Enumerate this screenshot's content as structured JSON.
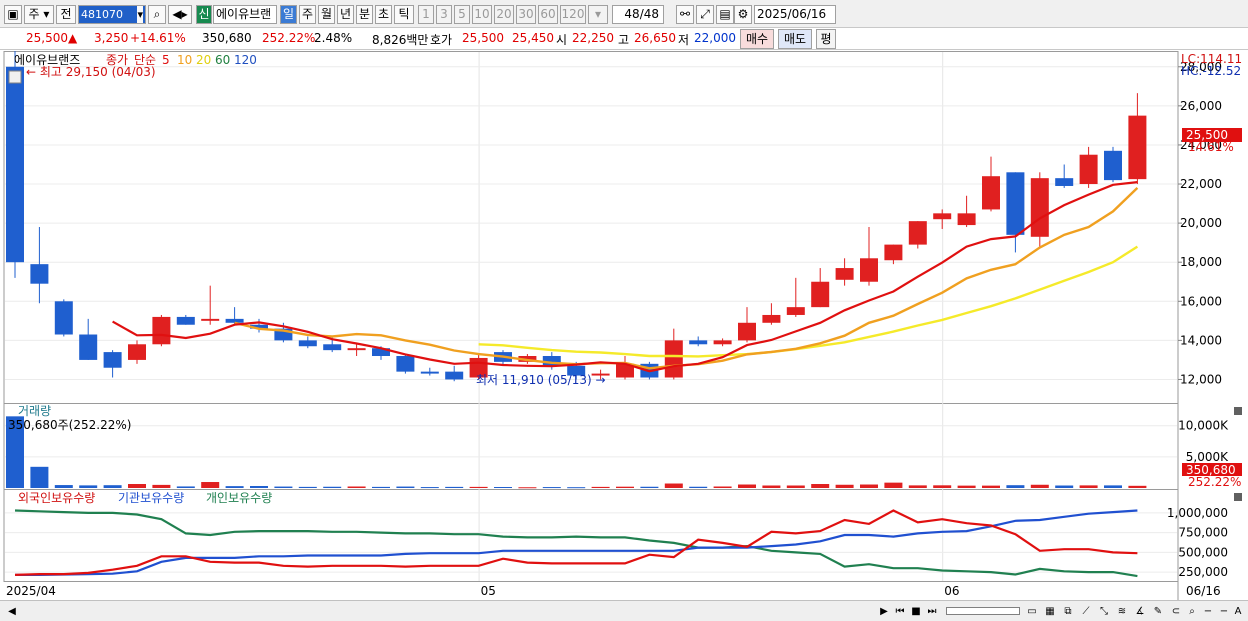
{
  "toolbar": {
    "period_main": "주",
    "prev_label": "전",
    "code": "481070",
    "credit_badge": "신",
    "stock_name": "에이유브랜",
    "periods": [
      "일",
      "주",
      "월",
      "년",
      "분",
      "초",
      "틱"
    ],
    "active_period": "일",
    "intervals": [
      "1",
      "3",
      "5",
      "10",
      "20",
      "30",
      "60",
      "120"
    ],
    "counter": "48",
    "counter_total": "/48",
    "date": "2025/06/16"
  },
  "quote": {
    "price": "25,500",
    "change": "3,250",
    "change_pct": "+14.61%",
    "volume": "350,680",
    "volume_ratio": "252.22%",
    "turnover_pct": "2.48%",
    "amount": "8,826백만",
    "ask_label": "호가",
    "ask": "25,500",
    "bid": "25,450",
    "open_label": "시",
    "open": "22,250",
    "high_label": "고",
    "high": "26,650",
    "low_label": "저",
    "low": "22,000",
    "buy_btn": "매수",
    "sell_btn": "매도",
    "eval_btn": "평"
  },
  "chart_data": {
    "type": "candlestick",
    "stock": "에이유브랜즈",
    "legend": {
      "close_label": "종가",
      "ma_label": "단순",
      "ma": [
        {
          "period": "5",
          "color": "#e01010"
        },
        {
          "period": "10",
          "color": "#f0a020"
        },
        {
          "period": "20",
          "color": "#f0e020"
        },
        {
          "period": "60",
          "color": "#208040"
        },
        {
          "period": "120",
          "color": "#2050c0"
        }
      ]
    },
    "lc_label": "LC:114.11",
    "hc_label": "HC:-12.52",
    "high_marker": "최고 29,150 (04/03)",
    "low_marker": "최저 11,910 (05/13)",
    "last_price": "25,500",
    "last_pct": "14.61%",
    "ylim": [
      11000,
      28500
    ],
    "y_ticks": [
      "28,000",
      "26,000",
      "24,000",
      "22,000",
      "20,000",
      "18,000",
      "16,000",
      "14,000",
      "12,000"
    ],
    "y_values": [
      28000,
      26000,
      24000,
      22000,
      20000,
      18000,
      16000,
      14000,
      12000
    ],
    "x_labels": [
      "2025/04",
      "05",
      "06",
      "06/16"
    ],
    "candles": [
      {
        "o": 28000,
        "h": 29150,
        "l": 17200,
        "c": 18000
      },
      {
        "o": 17900,
        "h": 19800,
        "l": 15900,
        "c": 16900
      },
      {
        "o": 16000,
        "h": 16100,
        "l": 14200,
        "c": 14300
      },
      {
        "o": 14300,
        "h": 15100,
        "l": 13000,
        "c": 13000
      },
      {
        "o": 13400,
        "h": 13500,
        "l": 12100,
        "c": 12600
      },
      {
        "o": 13000,
        "h": 14000,
        "l": 12800,
        "c": 13800
      },
      {
        "o": 13800,
        "h": 15300,
        "l": 13700,
        "c": 15200
      },
      {
        "o": 15200,
        "h": 15300,
        "l": 14800,
        "c": 14800
      },
      {
        "o": 15000,
        "h": 16800,
        "l": 14800,
        "c": 15100
      },
      {
        "o": 15100,
        "h": 15700,
        "l": 14800,
        "c": 14900
      },
      {
        "o": 14800,
        "h": 15100,
        "l": 14400,
        "c": 14600
      },
      {
        "o": 14600,
        "h": 14900,
        "l": 13900,
        "c": 14000
      },
      {
        "o": 14000,
        "h": 14200,
        "l": 13600,
        "c": 13700
      },
      {
        "o": 13800,
        "h": 14200,
        "l": 13400,
        "c": 13500
      },
      {
        "o": 13500,
        "h": 13800,
        "l": 13200,
        "c": 13600
      },
      {
        "o": 13600,
        "h": 13700,
        "l": 13000,
        "c": 13200
      },
      {
        "o": 13200,
        "h": 13300,
        "l": 12300,
        "c": 12400
      },
      {
        "o": 12400,
        "h": 12600,
        "l": 12200,
        "c": 12300
      },
      {
        "o": 12400,
        "h": 12700,
        "l": 11910,
        "c": 12000
      },
      {
        "o": 12100,
        "h": 13300,
        "l": 12000,
        "c": 13100
      },
      {
        "o": 13400,
        "h": 13500,
        "l": 12700,
        "c": 12900
      },
      {
        "o": 12900,
        "h": 13300,
        "l": 12800,
        "c": 13200
      },
      {
        "o": 13200,
        "h": 13400,
        "l": 12500,
        "c": 12700
      },
      {
        "o": 12700,
        "h": 12900,
        "l": 12000,
        "c": 12200
      },
      {
        "o": 12200,
        "h": 12500,
        "l": 12000,
        "c": 12300
      },
      {
        "o": 12100,
        "h": 13200,
        "l": 12000,
        "c": 12800
      },
      {
        "o": 12800,
        "h": 12900,
        "l": 12000,
        "c": 12100
      },
      {
        "o": 12100,
        "h": 14600,
        "l": 12000,
        "c": 14000
      },
      {
        "o": 14000,
        "h": 14200,
        "l": 13700,
        "c": 13800
      },
      {
        "o": 13800,
        "h": 14100,
        "l": 13700,
        "c": 14000
      },
      {
        "o": 14000,
        "h": 15700,
        "l": 13900,
        "c": 14900
      },
      {
        "o": 14900,
        "h": 15900,
        "l": 14800,
        "c": 15300
      },
      {
        "o": 15300,
        "h": 17200,
        "l": 15200,
        "c": 15700
      },
      {
        "o": 15700,
        "h": 17700,
        "l": 15700,
        "c": 17000
      },
      {
        "o": 17100,
        "h": 18200,
        "l": 16800,
        "c": 17700
      },
      {
        "o": 17000,
        "h": 19800,
        "l": 16800,
        "c": 18200
      },
      {
        "o": 18100,
        "h": 18900,
        "l": 17900,
        "c": 18900
      },
      {
        "o": 18900,
        "h": 20100,
        "l": 18700,
        "c": 20100
      },
      {
        "o": 20200,
        "h": 20700,
        "l": 19700,
        "c": 20500
      },
      {
        "o": 19900,
        "h": 21400,
        "l": 19800,
        "c": 20500
      },
      {
        "o": 20700,
        "h": 23400,
        "l": 20600,
        "c": 22400
      },
      {
        "o": 22600,
        "h": 22600,
        "l": 18500,
        "c": 19400
      },
      {
        "o": 19300,
        "h": 22600,
        "l": 18800,
        "c": 22300
      },
      {
        "o": 22300,
        "h": 23000,
        "l": 21800,
        "c": 21900
      },
      {
        "o": 22000,
        "h": 23900,
        "l": 21800,
        "c": 23500
      },
      {
        "o": 23700,
        "h": 23900,
        "l": 22100,
        "c": 22200
      },
      {
        "o": 22250,
        "h": 26650,
        "l": 22000,
        "c": 25500
      }
    ],
    "ma5": [
      null,
      null,
      null,
      null,
      14960,
      14260,
      14280,
      14120,
      14340,
      14800,
      14920,
      14720,
      14440,
      14060,
      13840,
      13600,
      13280,
      13020,
      12800,
      12860,
      12740,
      12700,
      12680,
      12760,
      12880,
      12800,
      12420,
      12680,
      12800,
      13140,
      13760,
      14020,
      14460,
      14900,
      15540,
      16040,
      16500,
      17260,
      17980,
      18800,
      19180,
      19320,
      20240,
      20920,
      21460,
      21960,
      22100
    ],
    "ma10": [
      null,
      null,
      null,
      null,
      null,
      null,
      null,
      null,
      null,
      14900,
      14590,
      14500,
      14280,
      14200,
      14320,
      14260,
      14000,
      13780,
      13480,
      13300,
      13170,
      12990,
      12850,
      12780,
      12830,
      12840,
      12570,
      12700,
      12780,
      12960,
      13280,
      13410,
      13570,
      13850,
      14240,
      14900,
      15260,
      15860,
      16440,
      17170,
      17610,
      17900,
      18750,
      19400,
      19800,
      20600,
      21800
    ],
    "ma20": [
      null,
      null,
      null,
      null,
      null,
      null,
      null,
      null,
      null,
      null,
      null,
      null,
      null,
      null,
      null,
      null,
      null,
      null,
      null,
      13800,
      13750,
      13620,
      13500,
      13420,
      13380,
      13300,
      13200,
      13200,
      13180,
      13240,
      13300,
      13400,
      13550,
      13720,
      13900,
      14180,
      14450,
      14760,
      15050,
      15400,
      15750,
      16150,
      16600,
      17050,
      17500,
      18000,
      18800
    ],
    "volume_panel": {
      "title": "거래량",
      "current": "350,680주(252.22%)",
      "y_ticks": [
        "10,000K",
        "5,000K"
      ],
      "y_values": [
        10000,
        5000
      ],
      "ylim": [
        0,
        13000
      ],
      "last_value": "350,680",
      "last_pct": "252.22%",
      "values": [
        11500,
        3400,
        470,
        420,
        450,
        640,
        500,
        250,
        960,
        300,
        320,
        230,
        180,
        200,
        240,
        180,
        230,
        150,
        180,
        180,
        160,
        120,
        150,
        130,
        180,
        210,
        200,
        720,
        200,
        240,
        560,
        400,
        400,
        640,
        520,
        560,
        860,
        420,
        430,
        380,
        380,
        450,
        520,
        400,
        420,
        420,
        350
      ]
    },
    "holdings_panel": {
      "legend": [
        "외국인보유수량",
        "기관보유수량",
        "개인보유수량"
      ],
      "colors": [
        "#e01010",
        "#2050d0",
        "#208050"
      ],
      "y_ticks": [
        "1,000,000",
        "750,000",
        "500,000",
        "250,000"
      ],
      "y_values": [
        1000000,
        750000,
        500000,
        250000
      ],
      "ylim": [
        150000,
        1100000
      ],
      "foreign": [
        215000,
        225000,
        225000,
        240000,
        280000,
        330000,
        450000,
        450000,
        380000,
        370000,
        370000,
        330000,
        320000,
        330000,
        330000,
        330000,
        320000,
        330000,
        330000,
        330000,
        420000,
        370000,
        360000,
        360000,
        360000,
        360000,
        470000,
        440000,
        660000,
        620000,
        570000,
        760000,
        740000,
        770000,
        910000,
        860000,
        1030000,
        880000,
        920000,
        870000,
        840000,
        730000,
        520000,
        540000,
        540000,
        500000,
        490000
      ],
      "institution": [
        215000,
        215000,
        220000,
        225000,
        230000,
        260000,
        380000,
        430000,
        430000,
        430000,
        450000,
        450000,
        460000,
        460000,
        460000,
        460000,
        480000,
        490000,
        490000,
        490000,
        520000,
        520000,
        520000,
        520000,
        520000,
        520000,
        520000,
        520000,
        560000,
        560000,
        560000,
        580000,
        600000,
        640000,
        720000,
        720000,
        700000,
        740000,
        760000,
        770000,
        830000,
        900000,
        910000,
        950000,
        990000,
        1010000,
        1030000
      ],
      "individual": [
        1030000,
        1020000,
        1010000,
        1000000,
        1000000,
        980000,
        920000,
        740000,
        720000,
        760000,
        770000,
        770000,
        770000,
        760000,
        760000,
        750000,
        740000,
        740000,
        730000,
        730000,
        700000,
        690000,
        690000,
        700000,
        690000,
        690000,
        650000,
        620000,
        560000,
        560000,
        580000,
        520000,
        500000,
        480000,
        320000,
        350000,
        300000,
        300000,
        270000,
        260000,
        250000,
        220000,
        290000,
        260000,
        250000,
        250000,
        200000
      ]
    }
  }
}
